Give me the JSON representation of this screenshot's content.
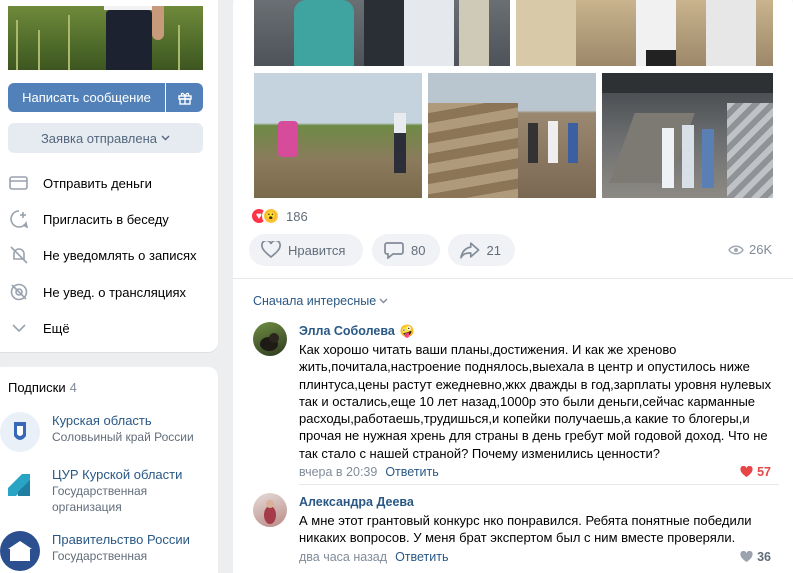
{
  "profile": {
    "write_message": "Написать сообщение",
    "request_sent": "Заявка отправлена",
    "actions": [
      {
        "label": "Отправить деньги",
        "icon": "money-transfer-icon"
      },
      {
        "label": "Пригласить в беседу",
        "icon": "invite-chat-icon"
      },
      {
        "label": "Не уведомлять о записях",
        "icon": "bell-off-icon"
      },
      {
        "label": "Не увед. о трансляциях",
        "icon": "broadcast-off-icon"
      },
      {
        "label": "Ещё",
        "icon": "chevron-down-icon"
      }
    ]
  },
  "subscriptions": {
    "title": "Подписки",
    "count": "4",
    "items": [
      {
        "name": "Курская область",
        "desc": "Соловьиный край России"
      },
      {
        "name": "ЦУР Курской области",
        "desc": "Государственная организация"
      },
      {
        "name": "Правительство России",
        "desc": "Государственная"
      }
    ]
  },
  "post": {
    "reactions_count": "186",
    "like_label": "Нравится",
    "comments_count": "80",
    "shares_count": "21",
    "views": "26K"
  },
  "comments": {
    "sort_label": "Сначала интересные",
    "items": [
      {
        "author": "Элла Соболева",
        "text": "Как хорошо читать ваши планы,достижения. И как же хреново жить,почитала,настроение поднялось,выехала в центр и опустилось ниже плинтуса,цены растут ежедневно,жкх дважды в год,зарплаты уровня нулевых так и остались,еще 10 лет назад,1000р это были деньги,сейчас карманные расходы,работаешь,трудишься,и копейки получаешь,а какие то блогеры,и прочая не нужная хрень для страны в день гребут мой годовой доход. Что не так стало с нашей страной? Почему изменились ценности?",
        "time": "вчера в 20:39",
        "reply": "Ответить",
        "likes": "57",
        "liked": true
      },
      {
        "author": "Александра Деева",
        "text": "А мне этот грантовый конкурс нко понравился. Ребята понятные победили никаких вопросов. У меня брат экспертом был с ним вместе проверяли.",
        "time": "два часа назад",
        "reply": "Ответить",
        "likes": "36",
        "liked": false
      }
    ]
  },
  "colors": {
    "accent": "#5181b8",
    "link": "#2a5885",
    "like_red": "#e64646",
    "muted": "#818c99"
  }
}
